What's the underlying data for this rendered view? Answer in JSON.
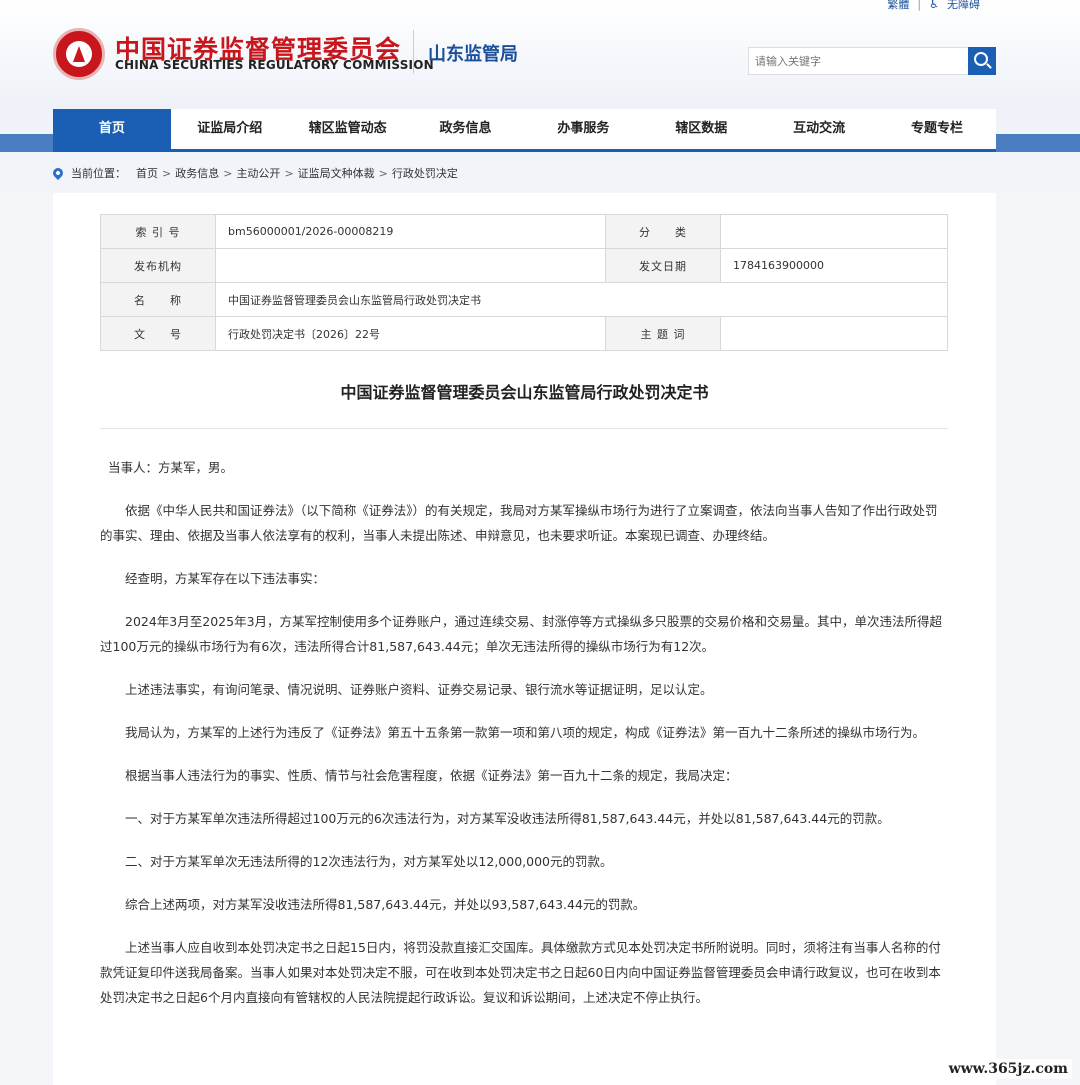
{
  "topbar": {
    "traditional": "繁體",
    "accessibility": "无障碍"
  },
  "header": {
    "logo_cn": "中国证券监督管理委员会",
    "logo_en": "CHINA SECURITIES REGULATORY COMMISSION",
    "bureau": "山东监管局",
    "search_placeholder": "请输入关键字"
  },
  "nav": {
    "items": [
      "首页",
      "证监局介绍",
      "辖区监管动态",
      "政务信息",
      "办事服务",
      "辖区数据",
      "互动交流",
      "专题专栏"
    ],
    "active_index": 0
  },
  "breadcrumb": {
    "prefix": "当前位置：",
    "items": [
      "首页",
      "政务信息",
      "主动公开",
      "证监局文种体裁",
      "行政处罚决定"
    ]
  },
  "meta": {
    "index_label": "索 引 号",
    "index_value": "bm56000001/2026-00008219",
    "category_label": "分　　类",
    "category_value": "",
    "publisher_label": "发布机构",
    "publisher_value": "",
    "date_label": "发文日期",
    "date_value": "1784163900000",
    "name_label": "名　　称",
    "name_value": "中国证券监督管理委员会山东监管局行政处罚决定书",
    "docno_label": "文　　号",
    "docno_value": "行政处罚决定书〔2026〕22号",
    "subject_label": "主 题 词",
    "subject_value": ""
  },
  "article": {
    "title": "中国证券监督管理委员会山东监管局行政处罚决定书",
    "paragraphs": [
      "当事人：方某军，男。",
      "依据《中华人民共和国证券法》（以下简称《证券法》）的有关规定，我局对方某军操纵市场行为进行了立案调查，依法向当事人告知了作出行政处罚的事实、理由、依据及当事人依法享有的权利，当事人未提出陈述、申辩意见，也未要求听证。本案现已调查、办理终结。",
      "经查明，方某军存在以下违法事实：",
      "2024年3月至2025年3月，方某军控制使用多个证券账户，通过连续交易、封涨停等方式操纵多只股票的交易价格和交易量。其中，单次违法所得超过100万元的操纵市场行为有6次，违法所得合计81,587,643.44元；单次无违法所得的操纵市场行为有12次。",
      "上述违法事实，有询问笔录、情况说明、证券账户资料、证券交易记录、银行流水等证据证明，足以认定。",
      "我局认为，方某军的上述行为违反了《证券法》第五十五条第一款第一项和第八项的规定，构成《证券法》第一百九十二条所述的操纵市场行为。",
      "根据当事人违法行为的事实、性质、情节与社会危害程度，依据《证券法》第一百九十二条的规定，我局决定：",
      "一、对于方某军单次违法所得超过100万元的6次违法行为，对方某军没收违法所得81,587,643.44元，并处以81,587,643.44元的罚款。",
      "二、对于方某军单次无违法所得的12次违法行为，对方某军处以12,000,000元的罚款。",
      "综合上述两项，对方某军没收违法所得81,587,643.44元，并处以93,587,643.44元的罚款。",
      "上述当事人应自收到本处罚决定书之日起15日内，将罚没款直接汇交国库。具体缴款方式见本处罚决定书所附说明。同时，须将注有当事人名称的付款凭证复印件送我局备案。当事人如果对本处罚决定不服，可在收到本处罚决定书之日起60日内向中国证券监督管理委员会申请行政复议，也可在收到本处罚决定书之日起6个月内直接向有管辖权的人民法院提起行政诉讼。复议和诉讼期间，上述决定不停止执行。"
    ]
  },
  "watermark": "www.365jz.com"
}
